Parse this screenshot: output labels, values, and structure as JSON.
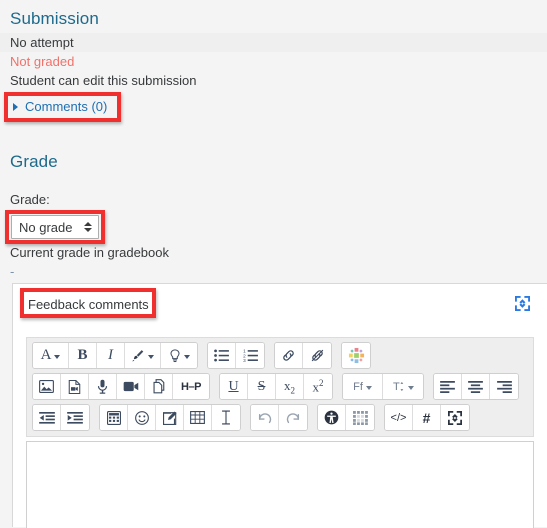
{
  "submission": {
    "heading": "Submission",
    "status_rows": [
      {
        "text": "No attempt",
        "style": "striped"
      },
      {
        "text": "Not graded",
        "style": "danger"
      },
      {
        "text": "Student can edit this submission",
        "style": "plain"
      }
    ],
    "comments_toggle_label": "Comments (0)",
    "comments_count": 0
  },
  "grade": {
    "heading": "Grade",
    "field_label": "Grade:",
    "select_value": "No grade",
    "select_options": [
      "No grade"
    ],
    "current_grade_label": "Current grade in gradebook",
    "current_grade_value": "-"
  },
  "feedback": {
    "label": "Feedback comments",
    "expand_icon": "expand-arrows-icon",
    "textarea_value": "",
    "toolbar": {
      "rows": [
        {
          "groups": [
            {
              "buttons": [
                {
                  "name": "font-style-icon",
                  "glyph": "A",
                  "caret": true
                },
                {
                  "name": "bold-icon",
                  "glyph": "B",
                  "caret": false
                },
                {
                  "name": "italic-icon",
                  "glyph": "I",
                  "caret": false
                },
                {
                  "name": "highlight-icon",
                  "glyph": "brush",
                  "caret": true
                },
                {
                  "name": "style-bulb-icon",
                  "glyph": "bulb",
                  "caret": true
                }
              ]
            },
            {
              "buttons": [
                {
                  "name": "bullet-list-icon",
                  "glyph": "ul",
                  "caret": false
                },
                {
                  "name": "numbered-list-icon",
                  "glyph": "ol",
                  "caret": false
                }
              ]
            },
            {
              "buttons": [
                {
                  "name": "link-icon",
                  "glyph": "link",
                  "caret": false
                },
                {
                  "name": "unlink-icon",
                  "glyph": "unlink",
                  "caret": false
                }
              ]
            },
            {
              "buttons": [
                {
                  "name": "equation-icon",
                  "glyph": "colorburst",
                  "caret": false
                }
              ]
            }
          ]
        },
        {
          "groups": [
            {
              "buttons": [
                {
                  "name": "insert-image-icon",
                  "glyph": "image",
                  "caret": false
                },
                {
                  "name": "insert-media-icon",
                  "glyph": "media",
                  "caret": false
                },
                {
                  "name": "record-audio-icon",
                  "glyph": "mic",
                  "caret": false
                },
                {
                  "name": "record-video-icon",
                  "glyph": "video",
                  "caret": false
                },
                {
                  "name": "manage-files-icon",
                  "glyph": "files",
                  "caret": false
                },
                {
                  "name": "h5p-icon",
                  "glyph": "H-P",
                  "caret": false
                }
              ]
            },
            {
              "buttons": [
                {
                  "name": "underline-icon",
                  "glyph": "U",
                  "caret": false
                },
                {
                  "name": "strikethrough-icon",
                  "glyph": "S",
                  "caret": false
                },
                {
                  "name": "subscript-icon",
                  "glyph": "x2sub",
                  "caret": false
                },
                {
                  "name": "superscript-icon",
                  "glyph": "x2sup",
                  "caret": false
                }
              ]
            },
            {
              "buttons": [
                {
                  "name": "font-family-icon",
                  "glyph": "Ff",
                  "caret": true
                },
                {
                  "name": "font-size-icon",
                  "glyph": "Tsize",
                  "caret": true
                }
              ]
            },
            {
              "buttons": [
                {
                  "name": "align-left-icon",
                  "glyph": "alignleft",
                  "caret": false
                },
                {
                  "name": "align-center-icon",
                  "glyph": "aligncenter",
                  "caret": false
                },
                {
                  "name": "align-right-icon",
                  "glyph": "alignright",
                  "caret": false
                }
              ]
            }
          ]
        },
        {
          "groups": [
            {
              "buttons": [
                {
                  "name": "indent-decrease-icon",
                  "glyph": "outdent",
                  "caret": false
                },
                {
                  "name": "indent-increase-icon",
                  "glyph": "indent",
                  "caret": false
                }
              ]
            },
            {
              "buttons": [
                {
                  "name": "calculator-icon",
                  "glyph": "calc",
                  "caret": false
                },
                {
                  "name": "emoticon-icon",
                  "glyph": "smiley",
                  "caret": false
                },
                {
                  "name": "insert-edit-icon",
                  "glyph": "pencil",
                  "caret": false
                },
                {
                  "name": "insert-table-icon",
                  "glyph": "table",
                  "caret": false
                },
                {
                  "name": "clear-formatting-icon",
                  "glyph": "Ibeam",
                  "caret": false
                }
              ]
            },
            {
              "buttons": [
                {
                  "name": "undo-icon",
                  "glyph": "undo",
                  "caret": false
                },
                {
                  "name": "redo-icon",
                  "glyph": "redo",
                  "caret": false
                }
              ]
            },
            {
              "buttons": [
                {
                  "name": "accessibility-checker-icon",
                  "glyph": "access",
                  "caret": false
                },
                {
                  "name": "screenreader-helper-icon",
                  "glyph": "srhelp",
                  "caret": false
                }
              ]
            },
            {
              "buttons": [
                {
                  "name": "html-source-icon",
                  "glyph": "code",
                  "caret": false
                },
                {
                  "name": "hashtag-icon",
                  "glyph": "hash",
                  "caret": false
                },
                {
                  "name": "fullscreen-icon",
                  "glyph": "fullscreen",
                  "caret": false
                }
              ]
            }
          ]
        }
      ]
    }
  },
  "annotations": [
    {
      "name": "annotation-comments",
      "target": "comments-toggle"
    },
    {
      "name": "annotation-grade-select",
      "target": "grade-select"
    },
    {
      "name": "annotation-feedback-label",
      "target": "feedback-label"
    }
  ],
  "colors": {
    "heading": "#1d6a8c",
    "link": "#1f6fb2",
    "danger": "#f0726a",
    "annotation": "#f0302e",
    "page_bg": "#f4f4f4",
    "toolbar_bg": "#eeeeee",
    "expand_blue": "#2a7ae2"
  }
}
